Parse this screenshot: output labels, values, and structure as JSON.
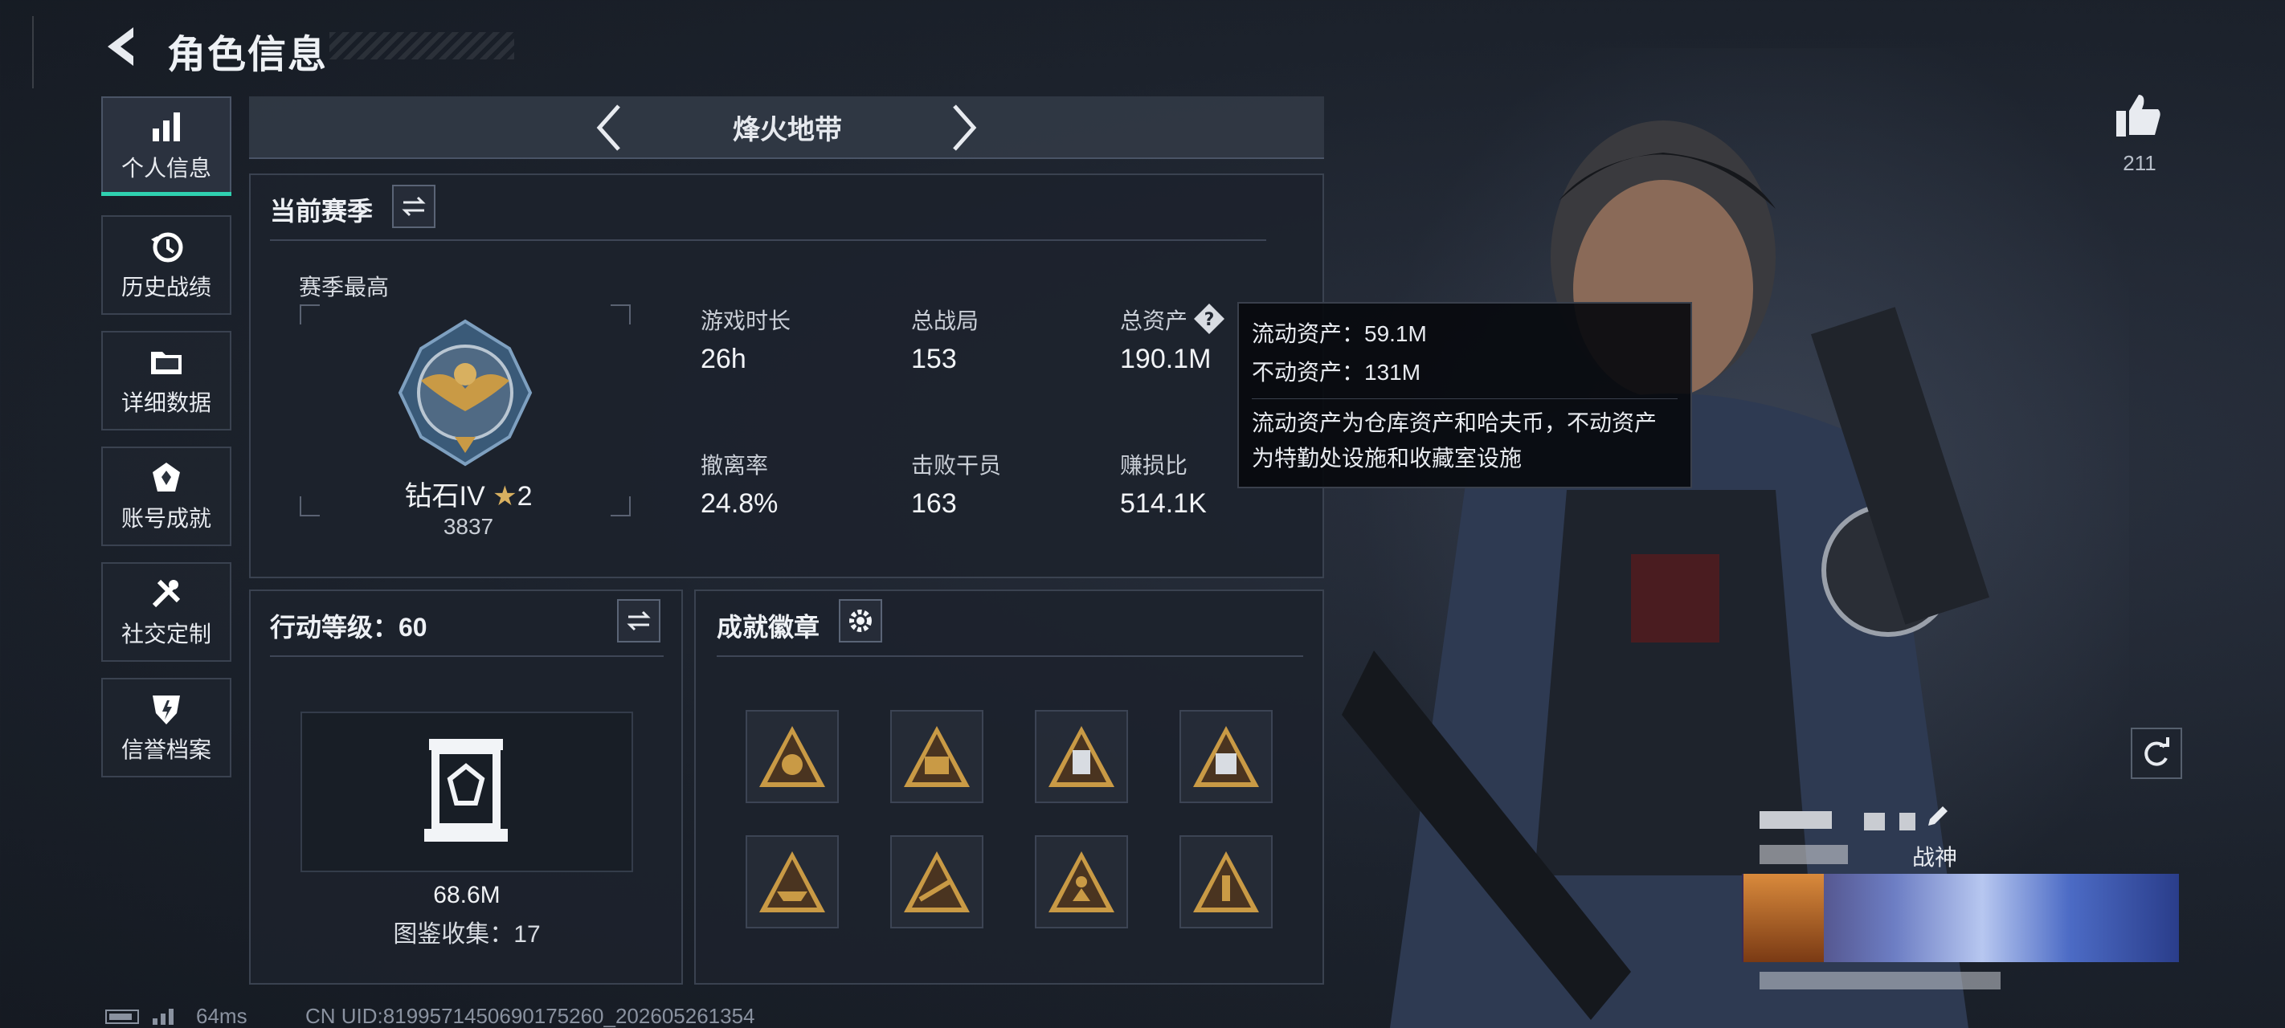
{
  "header": {
    "title": "角色信息"
  },
  "nav": {
    "items": [
      {
        "label": "个人信息",
        "icon": "bar-chart-icon",
        "active": true
      },
      {
        "label": "历史战绩",
        "icon": "history-icon"
      },
      {
        "label": "详细数据",
        "icon": "folder-icon"
      },
      {
        "label": "账号成就",
        "icon": "achievement-icon"
      },
      {
        "label": "社交定制",
        "icon": "tools-icon"
      },
      {
        "label": "信誉档案",
        "icon": "shield-icon"
      }
    ]
  },
  "season_bar": {
    "title": "烽火地带"
  },
  "current_season": {
    "title": "当前赛季",
    "best_label": "赛季最高",
    "rank_name": "钻石IV",
    "rank_stars": "2",
    "rank_points": "3837",
    "stats": [
      {
        "label": "游戏时长",
        "value": "26h"
      },
      {
        "label": "总战局",
        "value": "153"
      },
      {
        "label": "总资产",
        "value": "190.1M"
      },
      {
        "label": "撤离率",
        "value": "24.8%"
      },
      {
        "label": "击败干员",
        "value": "163"
      },
      {
        "label": "赚损比",
        "value": "514.1K"
      }
    ]
  },
  "tooltip": {
    "liquid": "流动资产：59.1M",
    "fixed": "不动资产：131M",
    "desc_line1": "流动资产为仓库资产和哈夫币，不动资产",
    "desc_line2": "为特勤处设施和收藏室设施"
  },
  "action_level": {
    "title": "行动等级：60",
    "value": "68.6M",
    "collection": "图鉴收集：17"
  },
  "achievements": {
    "title": "成就徽章",
    "badge_count": 8
  },
  "profile": {
    "likes": "211",
    "name_suffix": "战神"
  },
  "footer": {
    "ping": "64ms",
    "uid": "CN UID:8199571450690175260_202605261354"
  },
  "colors": {
    "accent": "#2fd1b0",
    "gold": "#c99a45",
    "background": "#1f2530"
  }
}
